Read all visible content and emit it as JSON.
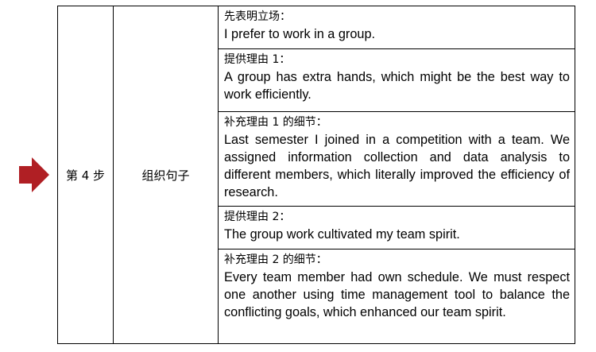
{
  "marker": {
    "color": "#b01f24",
    "icon": "right-arrow-icon"
  },
  "step": {
    "label": "第 4 步",
    "title": "组织句子"
  },
  "rows": [
    {
      "heading": "先表明立场：",
      "body": "I prefer to work in a group."
    },
    {
      "heading": "提供理由 1：",
      "body": "A group has extra hands, which might be the best way to work efficiently."
    },
    {
      "heading": "补充理由 1 的细节：",
      "body": "Last semester I joined in a competition with a team. We assigned information collection and data analysis to different members, which literally improved the efficiency of research."
    },
    {
      "heading": "提供理由 2：",
      "body": "The group work cultivated my team spirit."
    },
    {
      "heading": "补充理由 2 的细节：",
      "body": "Every team member had own schedule. We must respect one another using time management tool to balance the conflicting goals, which enhanced our team spirit."
    }
  ]
}
